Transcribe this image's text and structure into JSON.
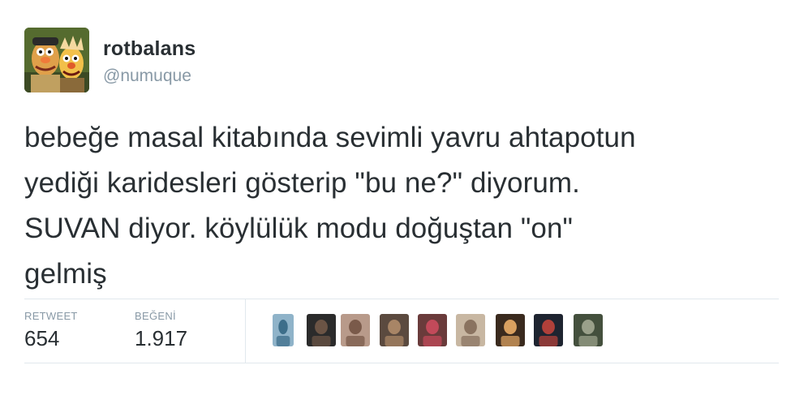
{
  "tweet": {
    "author": {
      "display_name": "rotbalans",
      "handle": "@numuque",
      "avatar_icon": "muppet-duo-avatar"
    },
    "text": "bebeğe masal kitabında sevimli yavru ahtapotun\nyediği karidesleri gösterip \"bu ne?\" diyorum.\nSUVAN diyor. köylülük modu doğuştan \"on\"\ngelmiş",
    "stats": {
      "retweet_label": "RETWEET",
      "retweet_count": "654",
      "likes_label": "BEĞENİ",
      "likes_count": "1.917"
    },
    "likers": [
      {
        "name": "liker-avatar-1",
        "color": "#8fb3c9",
        "accent": "#3d6e8a"
      },
      {
        "name": "liker-avatar-2",
        "color": "#2b2b2b",
        "accent": "#6b5445"
      },
      {
        "name": "liker-avatar-3",
        "color": "#b89a8a",
        "accent": "#7a5a4a"
      },
      {
        "name": "liker-avatar-4",
        "color": "#5b4a3f",
        "accent": "#a88566"
      },
      {
        "name": "liker-avatar-5",
        "color": "#6a3b3b",
        "accent": "#c24a5a"
      },
      {
        "name": "liker-avatar-6",
        "color": "#c8b7a2",
        "accent": "#8a7360"
      },
      {
        "name": "liker-avatar-7",
        "color": "#3a2a1e",
        "accent": "#d9a060"
      },
      {
        "name": "liker-avatar-8",
        "color": "#1e2430",
        "accent": "#b0403a"
      },
      {
        "name": "liker-avatar-9",
        "color": "#44503d",
        "accent": "#9aa08a"
      }
    ]
  },
  "colors": {
    "text_primary": "#292f33",
    "text_secondary": "#8899a6",
    "divider": "#e1e8ed",
    "background": "#ffffff"
  }
}
